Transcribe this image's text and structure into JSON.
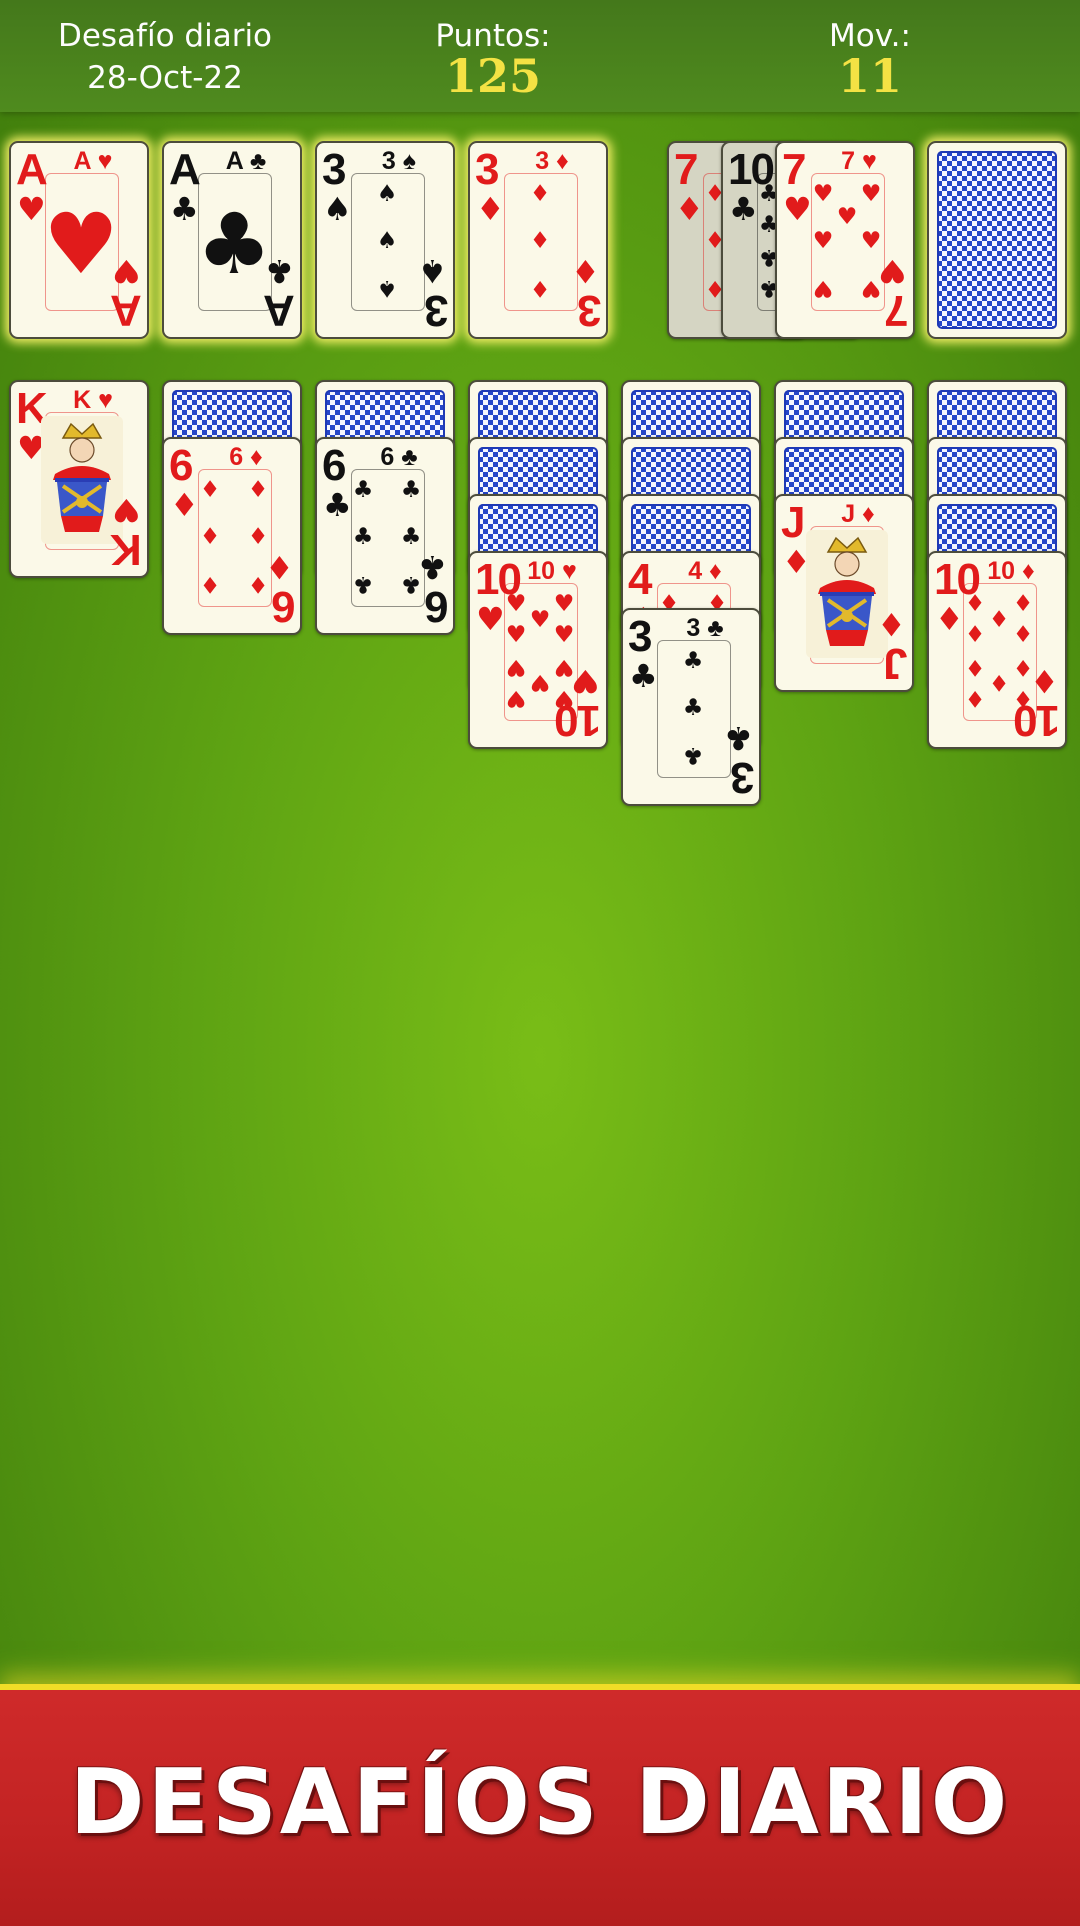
{
  "header": {
    "mode_title": "Desafío diario",
    "date": "28-Oct-22",
    "score_label": "Puntos:",
    "score_value": "125",
    "moves_label": "Mov.:",
    "moves_value": "11"
  },
  "foundations": [
    {
      "rank": "A",
      "suit": "♥",
      "color": "#e11b1b"
    },
    {
      "rank": "A",
      "suit": "♣",
      "color": "#111111"
    },
    {
      "rank": "3",
      "suit": "♠",
      "color": "#111111"
    },
    {
      "rank": "3",
      "suit": "♦",
      "color": "#e11b1b"
    }
  ],
  "waste": [
    {
      "rank": "7",
      "suit": "♦",
      "color": "#e11b1b"
    },
    {
      "rank": "10",
      "suit": "♣",
      "color": "#111111"
    },
    {
      "rank": "7",
      "suit": "♥",
      "color": "#e11b1b"
    }
  ],
  "stock": {
    "face_down": true
  },
  "tableau": [
    {
      "face_down": 0,
      "up": [
        {
          "rank": "K",
          "suit": "♥",
          "color": "#e11b1b"
        }
      ]
    },
    {
      "face_down": 1,
      "up": [
        {
          "rank": "6",
          "suit": "♦",
          "color": "#e11b1b"
        }
      ]
    },
    {
      "face_down": 1,
      "up": [
        {
          "rank": "6",
          "suit": "♣",
          "color": "#111111"
        }
      ]
    },
    {
      "face_down": 3,
      "up": [
        {
          "rank": "10",
          "suit": "♥",
          "color": "#e11b1b"
        }
      ]
    },
    {
      "face_down": 3,
      "up": [
        {
          "rank": "4",
          "suit": "♦",
          "color": "#e11b1b"
        },
        {
          "rank": "3",
          "suit": "♣",
          "color": "#111111"
        }
      ]
    },
    {
      "face_down": 2,
      "up": [
        {
          "rank": "J",
          "suit": "♦",
          "color": "#e11b1b"
        }
      ]
    },
    {
      "face_down": 3,
      "up": [
        {
          "rank": "10",
          "suit": "♦",
          "color": "#e11b1b"
        }
      ]
    }
  ],
  "banner": {
    "text": "DESAFÍOS DIARIO"
  },
  "colors": {
    "felt": "#6fb417",
    "header": "#4a841d",
    "banner": "#c82626",
    "accent": "#f4e244"
  }
}
